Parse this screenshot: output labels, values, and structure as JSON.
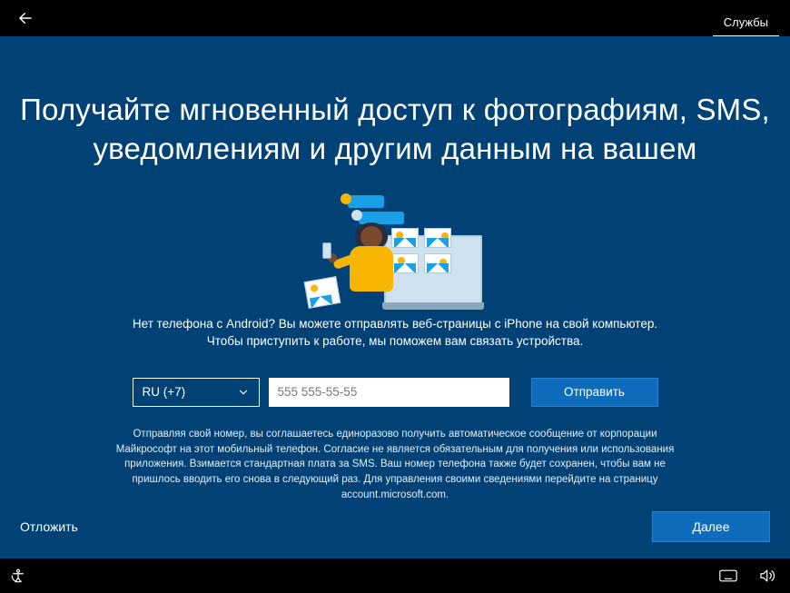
{
  "topbar": {
    "tab_services": "Службы"
  },
  "main": {
    "headline": "Получайте мгновенный доступ к фотографиям, SMS, уведомлениям и другим данным на вашем",
    "subhead": "Нет телефона с Android? Вы можете отправлять веб-страницы с iPhone на свой компьютер. Чтобы приступить к работе, мы поможем вам связать устройства.",
    "country_code": "RU (+7)",
    "phone_placeholder": "555 555-55-55",
    "send_label": "Отправить",
    "legal": "Отправляя свой номер, вы соглашаетесь единоразово получить автоматическое сообщение от корпорации Майкрософт на этот мобильный телефон. Согласие не является обязательным для получения или использования приложения. Взимается стандартная плата за SMS. Ваш номер телефона также будет сохранен, чтобы вам не пришлось вводить его снова в следующий раз. Для управления своими сведениями перейдите на страницу account.microsoft.com.",
    "postpone_label": "Отложить",
    "next_label": "Далее"
  }
}
